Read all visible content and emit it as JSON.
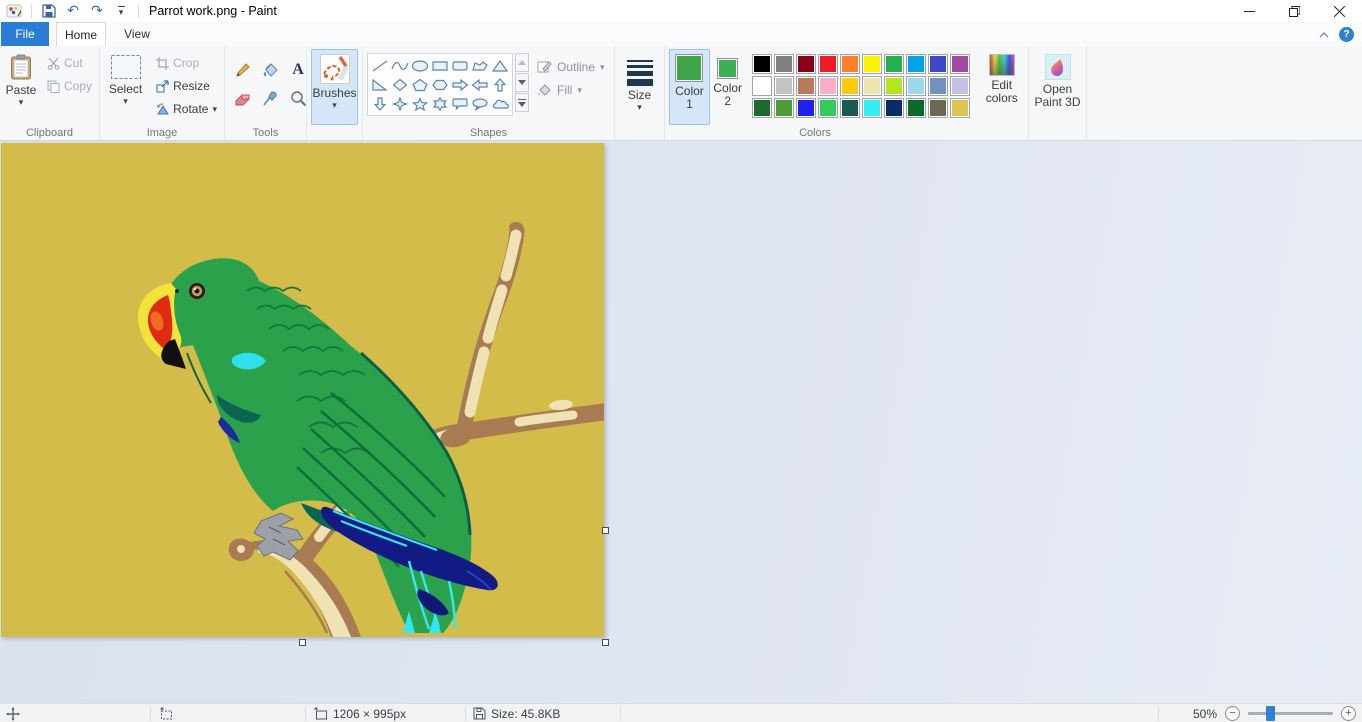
{
  "window": {
    "title": "Parrot work.png - Paint"
  },
  "tabs": {
    "file": "File",
    "home": "Home",
    "view": "View"
  },
  "ribbon": {
    "clipboard": {
      "label": "Clipboard",
      "paste": "Paste",
      "cut": "Cut",
      "copy": "Copy"
    },
    "image": {
      "label": "Image",
      "select": "Select",
      "crop": "Crop",
      "resize": "Resize",
      "rotate": "Rotate"
    },
    "tools": {
      "label": "Tools",
      "items": [
        "pencil",
        "fill-bucket",
        "text",
        "eraser",
        "color-picker",
        "magnifier"
      ]
    },
    "brushes": {
      "label": "Brushes",
      "selected": true
    },
    "shapes": {
      "label": "Shapes",
      "outline": "Outline",
      "fill": "Fill",
      "items": [
        "line",
        "curve",
        "oval",
        "rectangle",
        "rounded-rectangle",
        "polygon",
        "triangle",
        "right-triangle",
        "diamond",
        "pentagon",
        "hexagon",
        "arrow-right",
        "arrow-left",
        "arrow-up",
        "arrow-down",
        "four-point-star",
        "five-point-star",
        "six-point-star",
        "rounded-callout",
        "oval-callout",
        "cloud-callout"
      ]
    },
    "size": {
      "label": "Size"
    },
    "colors": {
      "label": "Colors",
      "color1": {
        "line1": "Color",
        "line2": "1",
        "value": "#3FA548",
        "selected": true
      },
      "color2": {
        "line1": "Color",
        "line2": "2",
        "value": "#3CB054"
      },
      "palette": [
        "#000000",
        "#7F7F7F",
        "#880015",
        "#ED1C24",
        "#FF7F27",
        "#FFF200",
        "#22B14C",
        "#00A2E8",
        "#3F48CC",
        "#A349A4",
        "#FFFFFF",
        "#C3C3C3",
        "#B97A57",
        "#FFAEC9",
        "#FFC90E",
        "#EFE4B0",
        "#B5E61D",
        "#99D9EA",
        "#7092BE",
        "#C8BFE7",
        "#1E6B30",
        "#4C9C38",
        "#2222EE",
        "#33CC5A",
        "#195B50",
        "#33EEF0",
        "#0C2A66",
        "#0A6B28",
        "#6E6850",
        "#DFC455"
      ],
      "edit_colors": {
        "line1": "Edit",
        "line2": "colors"
      }
    },
    "paint3d": {
      "line1": "Open",
      "line2": "Paint 3D"
    }
  },
  "canvas": {
    "background": "#D3BC49",
    "artwork": "eclectus-parrot-perched-on-branch"
  },
  "status_bar": {
    "dimensions": "1206 × 995px",
    "file_size": "Size: 45.8KB",
    "zoom": {
      "level": "50%"
    }
  }
}
